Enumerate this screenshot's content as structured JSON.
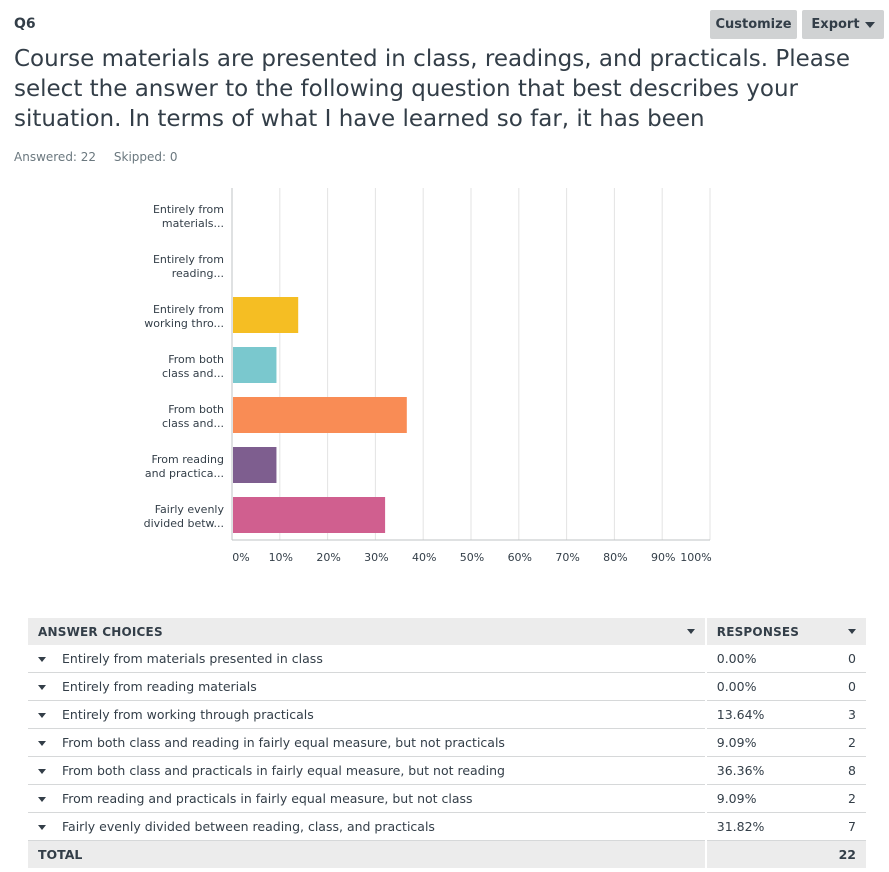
{
  "question": {
    "number": "Q6",
    "text": "Course materials are presented in class, readings, and practicals. Please select the answer to the following question that best describes your situation. In terms of what I have learned so far, it has been",
    "answered_label": "Answered: 22",
    "skipped_label": "Skipped: 0"
  },
  "toolbar": {
    "customize_label": "Customize",
    "export_label": "Export"
  },
  "colors": {
    "bars": [
      "#f5be23",
      "#f5be23",
      "#f5be23",
      "#7ac8ce",
      "#f98c55",
      "#7e5e8f",
      "#d05f8f"
    ],
    "grid": "#e3e3e3",
    "axis": "#bfc3c4"
  },
  "chart_data": {
    "type": "bar",
    "orientation": "horizontal",
    "categories": [
      "Entirely from materials...",
      "Entirely from reading...",
      "Entirely from working thro...",
      "From both class and...",
      "From both class and...",
      "From reading and practica...",
      "Fairly evenly divided betw..."
    ],
    "category_lines": [
      [
        "Entirely from",
        "materials..."
      ],
      [
        "Entirely from",
        "reading..."
      ],
      [
        "Entirely from",
        "working thro..."
      ],
      [
        "From both",
        "class and..."
      ],
      [
        "From both",
        "class and..."
      ],
      [
        "From reading",
        "and practica..."
      ],
      [
        "Fairly evenly",
        "divided betw..."
      ]
    ],
    "values": [
      0,
      0,
      13.64,
      9.09,
      36.36,
      9.09,
      31.82
    ],
    "xlim": [
      0,
      100
    ],
    "xticks": [
      "0%",
      "10%",
      "20%",
      "30%",
      "40%",
      "50%",
      "60%",
      "70%",
      "80%",
      "90%",
      "100%"
    ],
    "grid": true
  },
  "table": {
    "headers": {
      "choices": "ANSWER CHOICES",
      "responses": "RESPONSES"
    },
    "rows": [
      {
        "choice": "Entirely from materials presented in class",
        "percent": "0.00%",
        "count": "0"
      },
      {
        "choice": "Entirely from reading materials",
        "percent": "0.00%",
        "count": "0"
      },
      {
        "choice": "Entirely from working through practicals",
        "percent": "13.64%",
        "count": "3"
      },
      {
        "choice": "From both class and reading in fairly equal measure, but not practicals",
        "percent": "9.09%",
        "count": "2"
      },
      {
        "choice": "From both class and practicals in fairly equal measure, but not reading",
        "percent": "36.36%",
        "count": "8"
      },
      {
        "choice": "From reading and practicals in fairly equal measure, but not class",
        "percent": "9.09%",
        "count": "2"
      },
      {
        "choice": "Fairly evenly divided between reading, class, and practicals",
        "percent": "31.82%",
        "count": "7"
      }
    ],
    "total_label": "TOTAL",
    "total_count": "22"
  }
}
